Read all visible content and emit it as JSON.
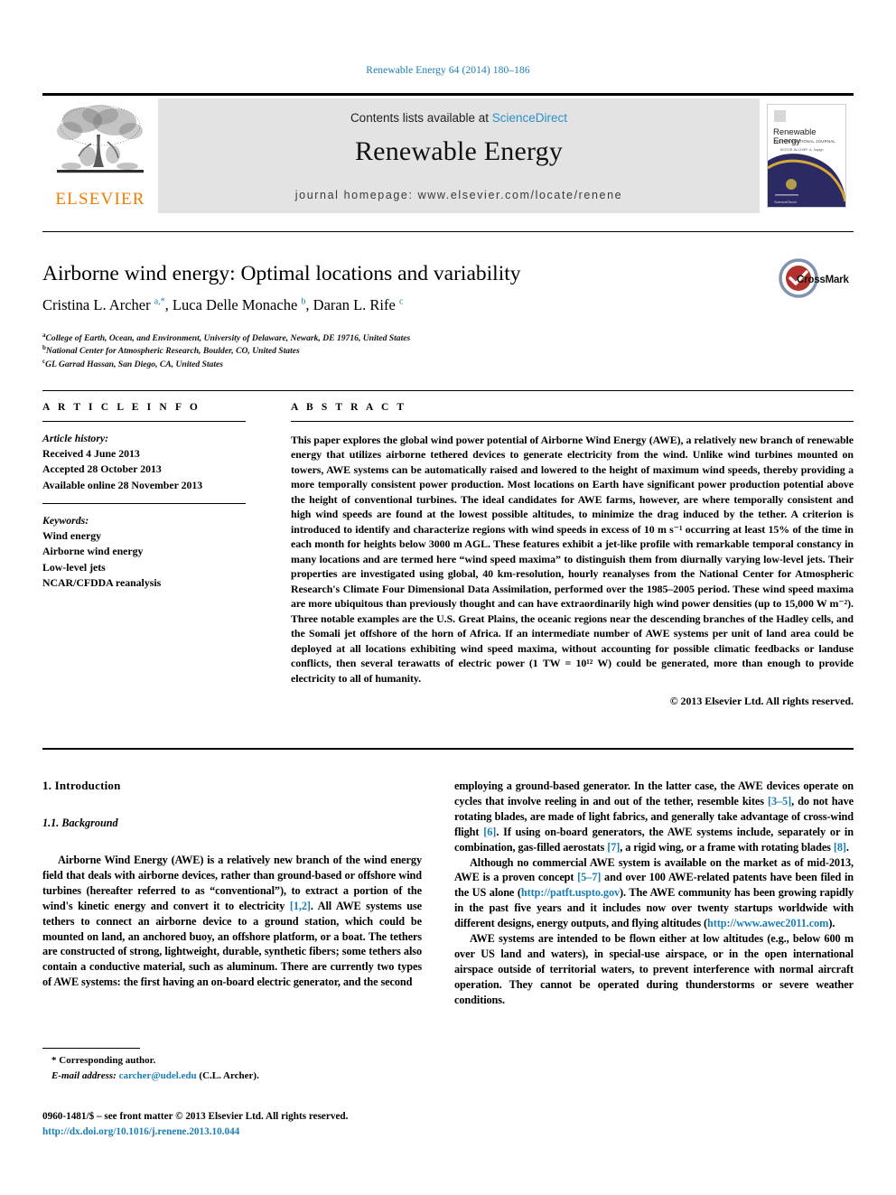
{
  "running_head": "Renewable Energy 64 (2014) 180–186",
  "masthead": {
    "publisher_name": "ELSEVIER",
    "contents_prefix": "Contents lists available at ",
    "contents_link": "ScienceDirect",
    "journal_title": "Renewable Energy",
    "homepage": "journal homepage: www.elsevier.com/locate/renene",
    "cover": {
      "title": "Renewable Energy",
      "subtitle": "AN INTERNATIONAL JOURNAL",
      "subtitle2": "EDITOR-IN-CHIEF: A. Sayigh"
    }
  },
  "article": {
    "title": "Airborne wind energy: Optimal locations and variability",
    "authors_html": "Cristina L. Archer <sup>a,*</sup>, Luca Delle Monache <sup>b</sup>, Daran L. Rife <sup>c</sup>",
    "affiliations": [
      {
        "marker": "a",
        "text": "College of Earth, Ocean, and Environment, University of Delaware, Newark, DE 19716, United States"
      },
      {
        "marker": "b",
        "text": "National Center for Atmospheric Research, Boulder, CO, United States"
      },
      {
        "marker": "c",
        "text": "GL Garrad Hassan, San Diego, CA, United States"
      }
    ],
    "crossmark_label": "CrossMark"
  },
  "article_info": {
    "heading": "A R T I C L E   I N F O",
    "history_label": "Article history:",
    "history": [
      "Received 4 June 2013",
      "Accepted 28 October 2013",
      "Available online 28 November 2013"
    ],
    "keywords_label": "Keywords:",
    "keywords": [
      "Wind energy",
      "Airborne wind energy",
      "Low-level jets",
      "NCAR/CFDDA reanalysis"
    ]
  },
  "abstract": {
    "heading": "A B S T R A C T",
    "text": "This paper explores the global wind power potential of Airborne Wind Energy (AWE), a relatively new branch of renewable energy that utilizes airborne tethered devices to generate electricity from the wind. Unlike wind turbines mounted on towers, AWE systems can be automatically raised and lowered to the height of maximum wind speeds, thereby providing a more temporally consistent power production. Most locations on Earth have significant power production potential above the height of conventional turbines. The ideal candidates for AWE farms, however, are where temporally consistent and high wind speeds are found at the lowest possible altitudes, to minimize the drag induced by the tether. A criterion is introduced to identify and characterize regions with wind speeds in excess of 10 m s⁻¹ occurring at least 15% of the time in each month for heights below 3000 m AGL. These features exhibit a jet-like profile with remarkable temporal constancy in many locations and are termed here “wind speed maxima” to distinguish them from diurnally varying low-level jets. Their properties are investigated using global, 40 km-resolution, hourly reanalyses from the National Center for Atmospheric Research's Climate Four Dimensional Data Assimilation, performed over the 1985–2005 period. These wind speed maxima are more ubiquitous than previously thought and can have extraordinarily high wind power densities (up to 15,000 W m⁻²). Three notable examples are the U.S. Great Plains, the oceanic regions near the descending branches of the Hadley cells, and the Somali jet offshore of the horn of Africa. If an intermediate number of AWE systems per unit of land area could be deployed at all locations exhibiting wind speed maxima, without accounting for possible climatic feedbacks or landuse conflicts, then several terawatts of electric power (1 TW = 10¹² W) could be generated, more than enough to provide electricity to all of humanity.",
    "copyright": "© 2013 Elsevier Ltd. All rights reserved."
  },
  "body": {
    "section1_heading": "1.  Introduction",
    "section11_heading": "1.1.  Background",
    "left_paragraphs": [
      "Airborne Wind Energy (AWE) is a relatively new branch of the wind energy field that deals with airborne devices, rather than ground-based or offshore wind turbines (hereafter referred to as “conventional”), to extract a portion of the wind's kinetic energy and convert it to electricity [1,2]. All AWE systems use tethers to connect an airborne device to a ground station, which could be mounted on land, an anchored buoy, an offshore platform, or a boat. The tethers are constructed of strong, lightweight, durable, synthetic fibers; some tethers also contain a conductive material, such as aluminum. There are currently two types of AWE systems: the first having an on-board electric generator, and the second"
    ],
    "right_paragraphs": [
      "employing a ground-based generator. In the latter case, the AWE devices operate on cycles that involve reeling in and out of the tether, resemble kites [3–5], do not have rotating blades, are made of light fabrics, and generally take advantage of cross-wind flight [6]. If using on-board generators, the AWE systems include, separately or in combination, gas-filled aerostats [7], a rigid wing, or a frame with rotating blades [8].",
      "Although no commercial AWE system is available on the market as of mid-2013, AWE is a proven concept [5–7] and over 100 AWE-related patents have been filed in the US alone (http://patft.uspto.gov). The AWE community has been growing rapidly in the past five years and it includes now over twenty startups worldwide with different designs, energy outputs, and flying altitudes (http://www.awec2011.com).",
      "AWE systems are intended to be flown either at low altitudes (e.g., below 600 m over US land and waters), in special-use airspace, or in the open international airspace outside of territorial waters, to prevent interference with normal aircraft operation. They cannot be operated during thunderstorms or severe weather conditions."
    ]
  },
  "footnote": {
    "corresponding": "* Corresponding author.",
    "email_label": "E-mail address:",
    "email": "carcher@udel.edu",
    "email_suffix": "(C.L. Archer)."
  },
  "footer": {
    "issn_line": "0960-1481/$ – see front matter © 2013 Elsevier Ltd. All rights reserved.",
    "doi": "http://dx.doi.org/10.1016/j.renene.2013.10.044"
  },
  "colors": {
    "link": "#1a7eb5",
    "sciencedirect": "#2c8fc9",
    "elsevier_orange": "#ef7d00",
    "masthead_grey": "#e3e3e3"
  }
}
